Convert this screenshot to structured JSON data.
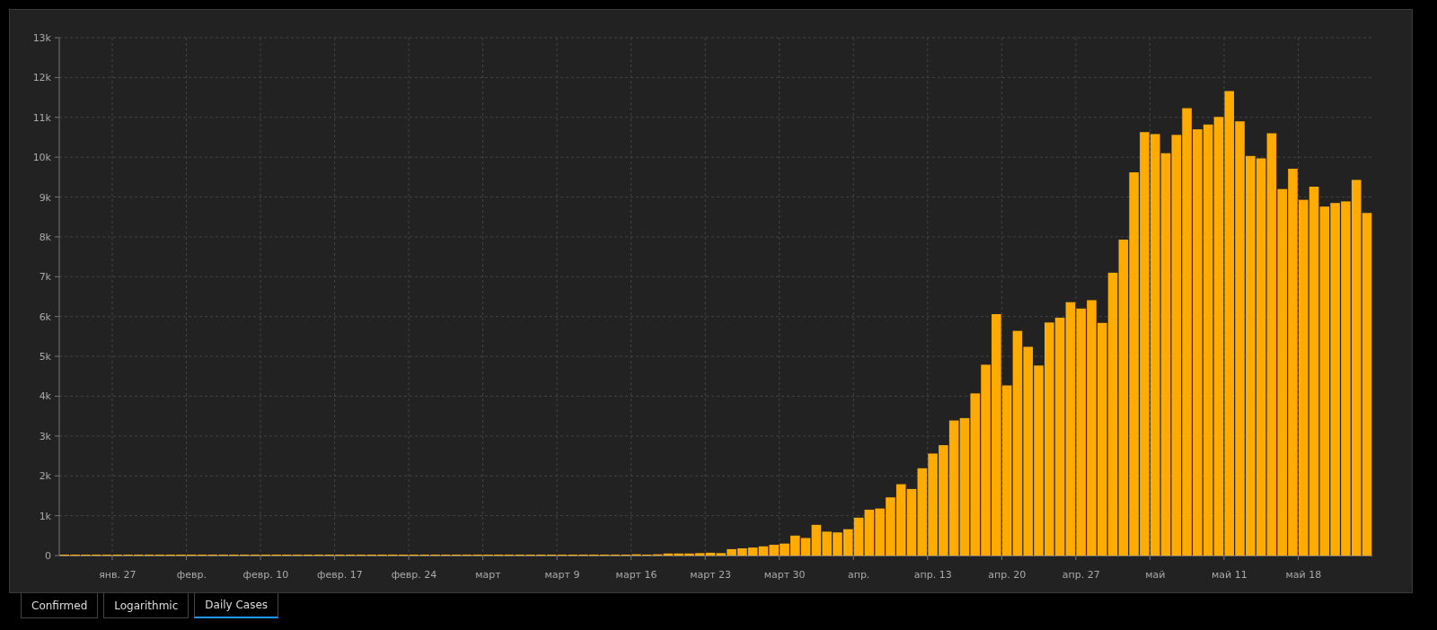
{
  "chart": {
    "chart_data": {
      "type": "bar",
      "grid": true,
      "categories": [
        null,
        null,
        null,
        null,
        null,
        "янв. 27",
        null,
        null,
        null,
        null,
        null,
        null,
        "февр.",
        null,
        null,
        null,
        null,
        null,
        null,
        "февр. 10",
        null,
        null,
        null,
        null,
        null,
        null,
        "февр. 17",
        null,
        null,
        null,
        null,
        null,
        null,
        "февр. 24",
        null,
        null,
        null,
        null,
        null,
        null,
        "март",
        null,
        null,
        null,
        null,
        null,
        null,
        "март 9",
        null,
        null,
        null,
        null,
        null,
        null,
        "март 16",
        null,
        null,
        null,
        null,
        null,
        null,
        "март 23",
        null,
        null,
        null,
        null,
        null,
        null,
        "март 30",
        null,
        null,
        null,
        null,
        null,
        null,
        "апр.",
        null,
        null,
        null,
        null,
        null,
        null,
        "апр. 13",
        null,
        null,
        null,
        null,
        null,
        null,
        "апр. 20",
        null,
        null,
        null,
        null,
        null,
        null,
        "апр. 27",
        null,
        null,
        null,
        null,
        null,
        null,
        "май",
        null,
        null,
        null,
        null,
        null,
        null,
        "май 11",
        null,
        null,
        null,
        null,
        null,
        null,
        "май 18",
        null,
        null,
        null,
        null,
        null,
        null
      ],
      "series": [
        {
          "color": "#ffab00",
          "values": [
            0,
            0,
            0,
            0,
            0,
            0,
            0,
            0,
            0,
            0,
            0,
            0,
            0,
            0,
            0,
            0,
            0,
            0,
            0,
            0,
            0,
            0,
            0,
            0,
            0,
            0,
            0,
            0,
            0,
            0,
            0,
            0,
            0,
            0,
            0,
            0,
            0,
            0,
            0,
            0,
            0,
            0,
            0,
            0,
            10,
            0,
            0,
            0,
            0,
            0,
            10,
            20,
            10,
            0,
            30,
            20,
            30,
            50,
            50,
            50,
            60,
            70,
            60,
            160,
            180,
            200,
            230,
            270,
            300,
            500,
            440,
            770,
            600,
            580,
            660,
            950,
            1150,
            1180,
            1460,
            1790,
            1670,
            2190,
            2560,
            2770,
            3390,
            3450,
            4070,
            4790,
            6060,
            4270,
            5640,
            5240,
            4770,
            5850,
            5970,
            6360,
            6200,
            6410,
            5840,
            7100,
            7930,
            9620,
            10630,
            10580,
            10100,
            10560,
            11230,
            10700,
            10820,
            11010,
            11660,
            10900,
            10030,
            9970,
            10600,
            9200,
            9710,
            8930,
            9260,
            8760,
            8850,
            8890,
            9430,
            8600
          ]
        }
      ],
      "ylim": [
        0,
        13000
      ],
      "yticks": [
        {
          "value": 0,
          "label": "0"
        },
        {
          "value": 1000,
          "label": "1k"
        },
        {
          "value": 2000,
          "label": "2k"
        },
        {
          "value": 3000,
          "label": "3k"
        },
        {
          "value": 4000,
          "label": "4k"
        },
        {
          "value": 5000,
          "label": "5k"
        },
        {
          "value": 6000,
          "label": "6k"
        },
        {
          "value": 7000,
          "label": "7k"
        },
        {
          "value": 8000,
          "label": "8k"
        },
        {
          "value": 9000,
          "label": "9k"
        },
        {
          "value": 10000,
          "label": "10k"
        },
        {
          "value": 11000,
          "label": "11k"
        },
        {
          "value": 12000,
          "label": "12k"
        },
        {
          "value": 13000,
          "label": "13k"
        }
      ]
    }
  },
  "tabs": [
    {
      "label": "Confirmed",
      "selected": false
    },
    {
      "label": "Logarithmic",
      "selected": false
    },
    {
      "label": "Daily Cases",
      "selected": true
    }
  ]
}
